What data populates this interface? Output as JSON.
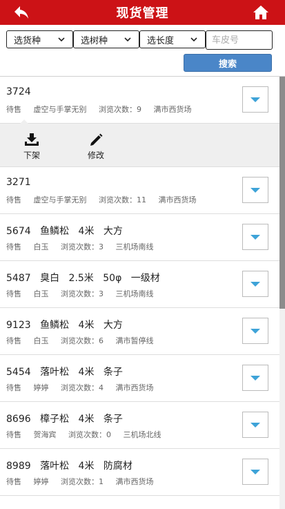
{
  "header": {
    "title": "现货管理",
    "back_icon": "back-arrow-icon",
    "home_icon": "home-icon",
    "background": "#cc1216"
  },
  "filters": {
    "species": "选货种",
    "wood": "选树种",
    "length": "选长度",
    "plate_placeholder": "车皮号"
  },
  "search_label": "搜索",
  "accent": "#4a86c8",
  "actions": {
    "delist": "下架",
    "edit": "修改"
  },
  "items": [
    {
      "title": [
        "3724"
      ],
      "status": "待售",
      "seller": "虚空与手掌无别",
      "views": "浏览次数：9",
      "place": "满市西货场"
    },
    {
      "title": [
        "3271"
      ],
      "status": "待售",
      "seller": "虚空与手掌无别",
      "views": "浏览次数：11",
      "place": "满市西货场"
    },
    {
      "title": [
        "5674",
        "鱼鳞松",
        "4米",
        "大方"
      ],
      "status": "待售",
      "seller": "白玉",
      "views": "浏览次数：3",
      "place": "三机场南线"
    },
    {
      "title": [
        "5487",
        "臭白",
        "2.5米",
        "50φ",
        "一级材"
      ],
      "status": "待售",
      "seller": "白玉",
      "views": "浏览次数：3",
      "place": "三机场南线"
    },
    {
      "title": [
        "9123",
        "鱼鳞松",
        "4米",
        "大方"
      ],
      "status": "待售",
      "seller": "白玉",
      "views": "浏览次数：6",
      "place": "满市暂停线"
    },
    {
      "title": [
        "5454",
        "落叶松",
        "4米",
        "条子"
      ],
      "status": "待售",
      "seller": "婷婷",
      "views": "浏览次数：4",
      "place": "满市西货场"
    },
    {
      "title": [
        "8696",
        "樟子松",
        "4米",
        "条子"
      ],
      "status": "待售",
      "seller": "贺海宾",
      "views": "浏览次数：0",
      "place": "三机场北线"
    },
    {
      "title": [
        "8989",
        "落叶松",
        "4米",
        "防腐材"
      ],
      "status": "待售",
      "seller": "婷婷",
      "views": "浏览次数：1",
      "place": "满市西货场"
    }
  ]
}
